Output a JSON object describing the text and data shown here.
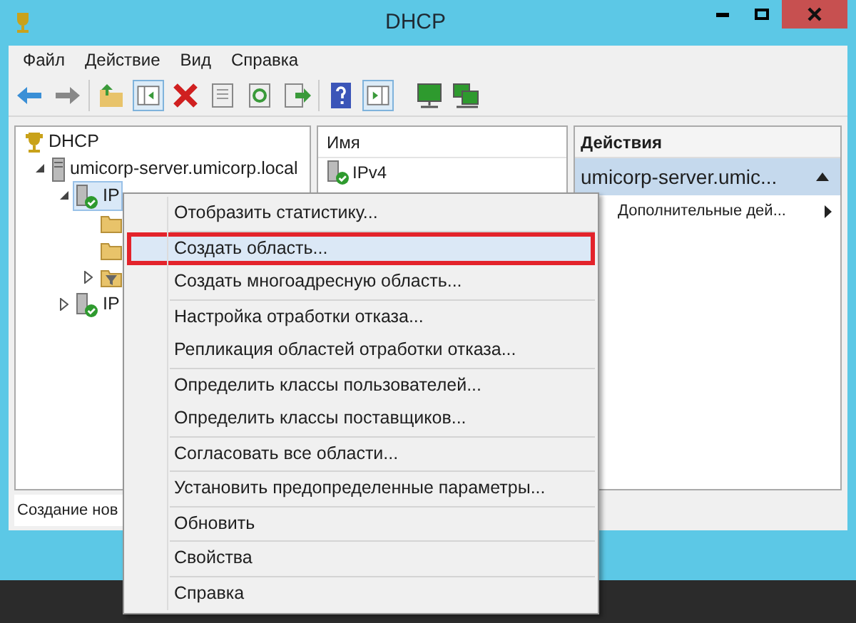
{
  "window": {
    "title": "DHCP"
  },
  "menubar": [
    "Файл",
    "Действие",
    "Вид",
    "Справка"
  ],
  "tree": [
    {
      "label": "DHCP",
      "kind": "dhcp",
      "selected": false,
      "children": [
        {
          "label": "umicorp-server.umicorp.local",
          "kind": "server",
          "expanded": true,
          "selected": false,
          "children": [
            {
              "label": "IP",
              "kind": "protocol",
              "expanded": true,
              "selected": true,
              "children": [
                {
                  "kind": "folder",
                  "selected": false
                },
                {
                  "kind": "folder",
                  "selected": false
                },
                {
                  "kind": "filter",
                  "expanded": false,
                  "selected": false
                }
              ]
            },
            {
              "label": "IP",
              "kind": "protocol",
              "expanded": false,
              "selected": false
            }
          ]
        }
      ]
    }
  ],
  "list": {
    "columns": [
      "Имя"
    ],
    "rows": [
      "IPv4"
    ]
  },
  "actions": {
    "title": "Действия",
    "section": "umicorp-server.umic...",
    "items": [
      "Дополнительные дей..."
    ]
  },
  "status_bar": "Создание нов",
  "context_menu": [
    [
      {
        "label": "Отобразить статистику...",
        "selected": false
      }
    ],
    [
      {
        "label": "Создать область...",
        "selected": true
      },
      {
        "label": "Создать многоадресную область...",
        "selected": false
      }
    ],
    [
      {
        "label": "Настройка отработки отказа...",
        "selected": false
      },
      {
        "label": "Репликация областей отработки отказа...",
        "selected": false
      }
    ],
    [
      {
        "label": "Определить классы пользователей...",
        "selected": false
      },
      {
        "label": "Определить классы поставщиков...",
        "selected": false
      }
    ],
    [
      {
        "label": "Согласовать все области...",
        "selected": false
      }
    ],
    [
      {
        "label": "Установить предопределенные параметры...",
        "selected": false
      }
    ],
    [
      {
        "label": "Обновить",
        "selected": false
      }
    ],
    [
      {
        "label": "Свойства",
        "selected": false
      }
    ],
    [
      {
        "label": "Справка",
        "selected": false
      }
    ]
  ]
}
